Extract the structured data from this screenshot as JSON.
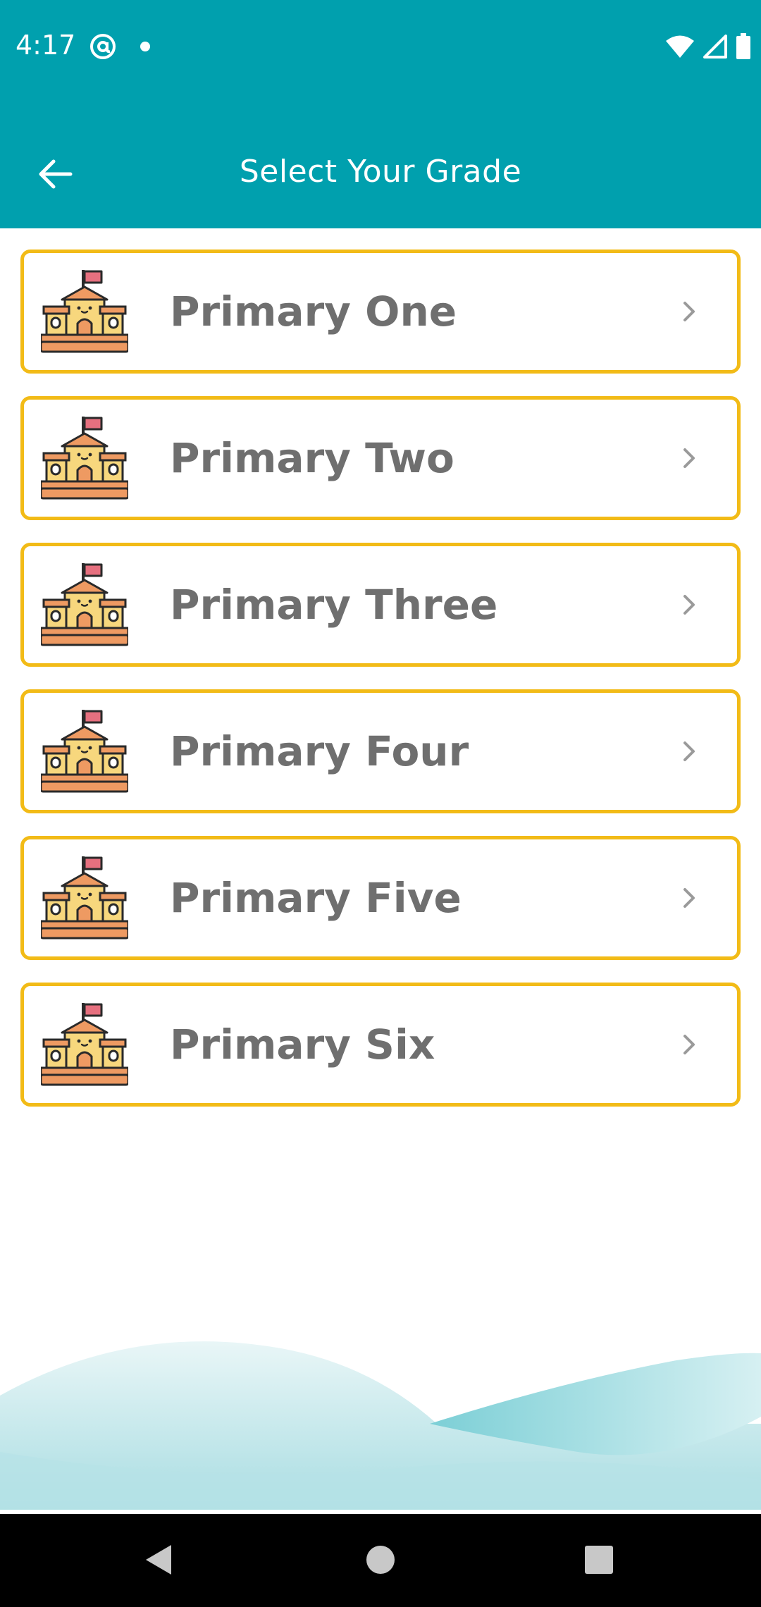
{
  "status_bar": {
    "time": "4:17",
    "left_icon": "at-sign-notification-icon",
    "right_icons": [
      "wifi-icon",
      "cellular-signal-icon",
      "battery-icon"
    ]
  },
  "app_bar": {
    "title": "Select Your Grade",
    "back_icon": "arrow-left-icon",
    "background_color": "#00a0ae"
  },
  "grades": [
    {
      "label": "Primary One",
      "icon": "school-building-icon"
    },
    {
      "label": "Primary Two",
      "icon": "school-building-icon"
    },
    {
      "label": "Primary Three",
      "icon": "school-building-icon"
    },
    {
      "label": "Primary Four",
      "icon": "school-building-icon"
    },
    {
      "label": "Primary Five",
      "icon": "school-building-icon"
    },
    {
      "label": "Primary Six",
      "icon": "school-building-icon"
    }
  ],
  "colors": {
    "accent": "#00a0ae",
    "card_border": "#f2bb17",
    "label_text": "#6f6f6f"
  },
  "nav_bar": {
    "icons": [
      "back-triangle-icon",
      "home-circle-icon",
      "recents-square-icon"
    ]
  }
}
